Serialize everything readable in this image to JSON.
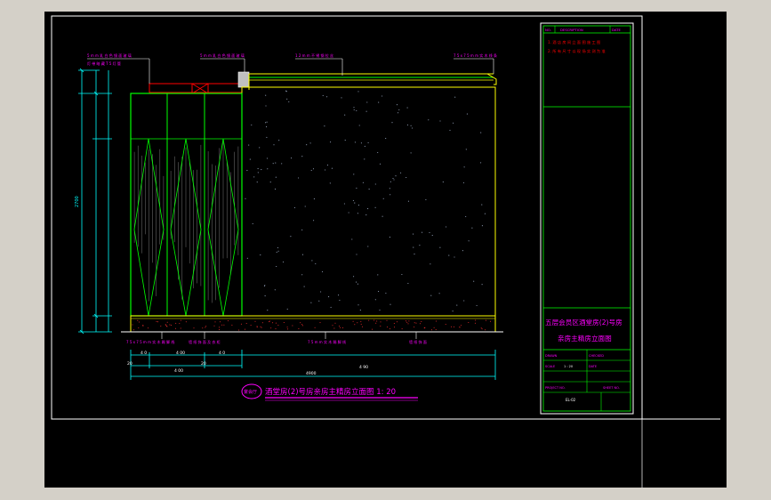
{
  "drawing": {
    "title": "酒堂房(2)号房亲房主精房立面图 1: 20",
    "title_badge": "宴会厅",
    "total_dimension": "4900",
    "segment_dimensions": [
      "20",
      "4 00",
      "20",
      "4 90"
    ],
    "sub_dimensions": [
      "4 0",
      "4 00",
      "4 0"
    ],
    "vertical_dimension": "2700",
    "annotations_top": [
      "5 m m 乳 白 色 镜 面 玻 璃",
      "灯 带 暗 藏 T 5 灯 管",
      "5 m m 乳 白 色 镜 面 玻 璃",
      "1 2 m m 不 锈 钢 拉 丝",
      "7 5 x 7 5 m m 实 木 线 条"
    ],
    "annotations_bottom": [
      "7 5 x 7 5 m m 实 木 踢 脚 线",
      "墙 纸 饰 面 及 衣 柜",
      "7 5 m m 实 木 踢 脚 线",
      "墙 纸 饰 面"
    ]
  },
  "title_block": {
    "header_cells": [
      "NO.",
      "DESCRIPTION",
      "DATE"
    ],
    "revision_lines": [
      "1. 酒 店 房 间 立 面 图 施 工 图",
      "2. 所 有 尺 寸 以 现 场 实 测 为 准"
    ],
    "project_name": "五层会员区酒堂房(2)号房",
    "sheet_name": "亲房主精房立面图",
    "field_labels": [
      "DRAWN",
      "CHECKED",
      "SCALE",
      "DATE",
      "PROJECT NO.",
      "SHEET NO."
    ],
    "scale_value": "1 : 20",
    "sheet_number": "EL-02"
  },
  "colors": {
    "background": "#000000",
    "frame": "#ffffff",
    "outline": "#ffff00",
    "cabinet": "#00ff00",
    "dimension": "#00ffff",
    "annotation": "#ff00ff",
    "revision": "#ff0000"
  }
}
